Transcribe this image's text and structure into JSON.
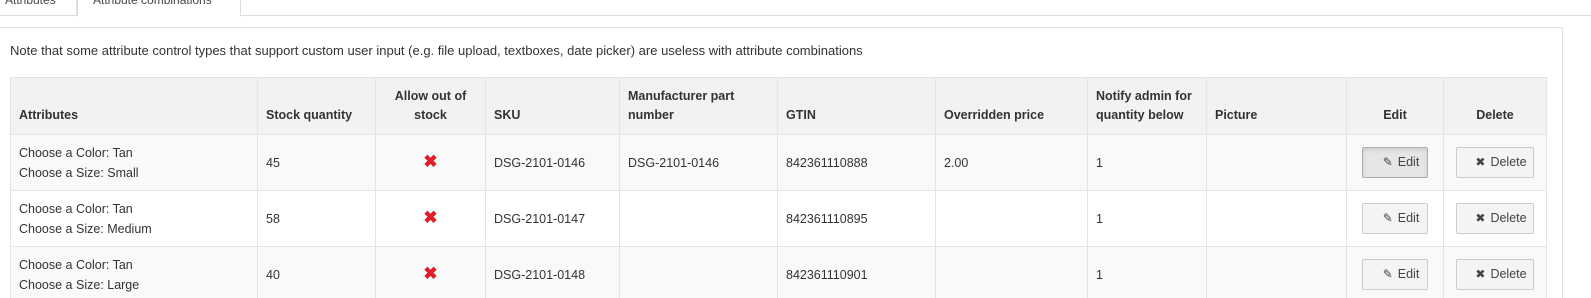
{
  "tabs": [
    {
      "label": "Attributes"
    },
    {
      "label": "Attribute combinations"
    }
  ],
  "note": "Note that some attribute control types that support custom user input (e.g. file upload, textboxes, date picker) are useless with attribute combinations",
  "table": {
    "headers": {
      "attributes": "Attributes",
      "stock_quantity": "Stock quantity",
      "allow_out_of_stock_1": "Allow out of",
      "allow_out_of_stock_2": "stock",
      "sku": "SKU",
      "mpn_1": "Manufacturer part",
      "mpn_2": "number",
      "gtin": "GTIN",
      "overridden_price": "Overridden price",
      "notify_1": "Notify admin for",
      "notify_2": "quantity below",
      "picture": "Picture",
      "edit": "Edit",
      "delete": "Delete"
    },
    "rows": [
      {
        "attr1": "Choose a Color: Tan",
        "attr2": "Choose a Size: Small",
        "stock": "45",
        "allow": "✖",
        "sku": "DSG-2101-0146",
        "mpn": "DSG-2101-0146",
        "gtin": "842361110888",
        "price": "2.00",
        "notify": "1",
        "picture": "",
        "edit": "Edit",
        "delete": "Delete"
      },
      {
        "attr1": "Choose a Color: Tan",
        "attr2": "Choose a Size: Medium",
        "stock": "58",
        "allow": "✖",
        "sku": "DSG-2101-0147",
        "mpn": "",
        "gtin": "842361110895",
        "price": "",
        "notify": "1",
        "picture": "",
        "edit": "Edit",
        "delete": "Delete"
      },
      {
        "attr1": "Choose a Color: Tan",
        "attr2": "Choose a Size: Large",
        "stock": "40",
        "allow": "✖",
        "sku": "DSG-2101-0148",
        "mpn": "",
        "gtin": "842361110901",
        "price": "",
        "notify": "1",
        "picture": "",
        "edit": "Edit",
        "delete": "Delete"
      }
    ]
  },
  "icons": {
    "edit": "pencil-icon",
    "delete": "times-icon",
    "not_allowed": "red-x-icon"
  },
  "colors": {
    "red_x": "#dd1f26",
    "header_bg": "#f2f2f2"
  }
}
